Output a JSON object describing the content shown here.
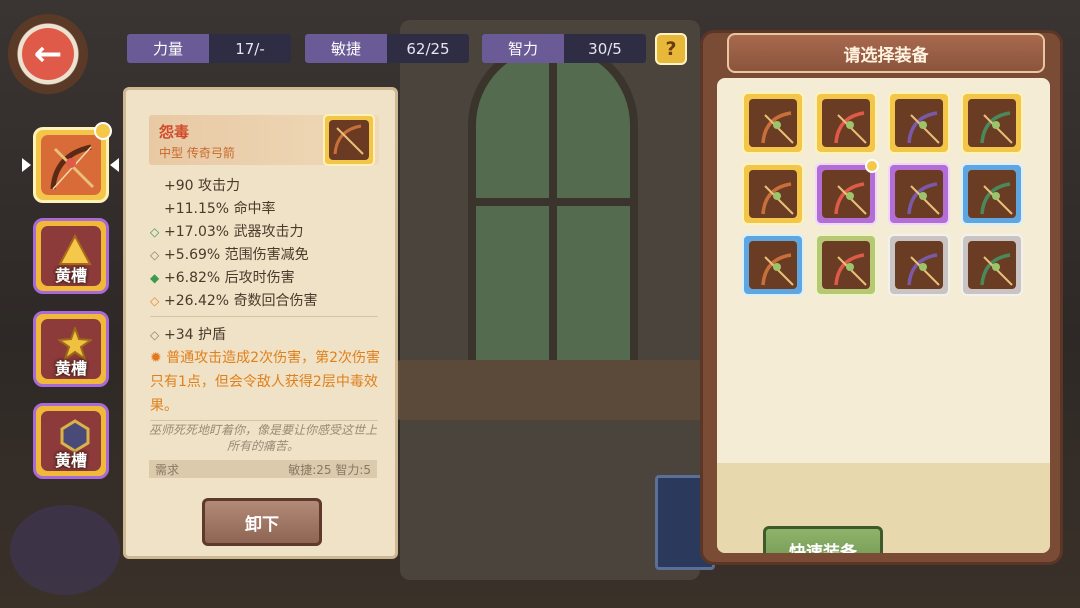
{
  "stats": [
    {
      "label": "力量",
      "value": "17/-"
    },
    {
      "label": "敏捷",
      "value": "62/25"
    },
    {
      "label": "智力",
      "value": "30/5"
    }
  ],
  "help_icon": "?",
  "back_icon": "arrow-left-icon",
  "slots": [
    {
      "label": "",
      "rarity": "gold",
      "icon": "bow-icon",
      "selected": true
    },
    {
      "label": "黄槽",
      "rarity": "gold",
      "icon": "topaz-gem-icon"
    },
    {
      "label": "黄槽",
      "rarity": "gold",
      "icon": "gold-gem-icon"
    },
    {
      "label": "黄槽",
      "rarity": "gold",
      "icon": "dark-gem-icon"
    }
  ],
  "detail": {
    "name": "怨毒",
    "type": "中型 传奇弓箭",
    "attributes": [
      {
        "marker": "",
        "text": "+90 攻击力"
      },
      {
        "marker": "",
        "text": "+11.15% 命中率"
      },
      {
        "marker": "green",
        "text": "+17.03% 武器攻击力"
      },
      {
        "marker": "gray",
        "text": "+5.69% 范围伤害减免"
      },
      {
        "marker": "green",
        "text": "+6.82% 后攻时伤害"
      },
      {
        "marker": "orange",
        "text": "+26.42% 奇数回合伤害"
      }
    ],
    "shield": "+34 护盾",
    "effect": "普通攻击造成2次伤害，第2次伤害只有1点，但会令敌人获得2层中毒效果。",
    "lore": "巫师死死地盯着你，像是要让你感受这世上所有的痛苦。",
    "requirement_label": "需求",
    "requirement_value": "敏捷:25 智力:5",
    "unequip_label": "卸下"
  },
  "select_panel": {
    "title": "请选择装备",
    "quick_equip_label": "快速装备",
    "items": [
      {
        "rarity": "gold",
        "icon": "bow-icon"
      },
      {
        "rarity": "gold",
        "icon": "bow-icon"
      },
      {
        "rarity": "gold",
        "icon": "bow-icon"
      },
      {
        "rarity": "gold",
        "icon": "bow-icon"
      },
      {
        "rarity": "gold",
        "icon": "bow-icon"
      },
      {
        "rarity": "purple",
        "icon": "bow-icon",
        "equipped": true
      },
      {
        "rarity": "purple",
        "icon": "bow-icon"
      },
      {
        "rarity": "blue",
        "icon": "bow-icon"
      },
      {
        "rarity": "blue",
        "icon": "bow-icon"
      },
      {
        "rarity": "green",
        "icon": "bow-icon"
      },
      {
        "rarity": "gray",
        "icon": "bow-icon"
      },
      {
        "rarity": "gray",
        "icon": "bow-icon"
      }
    ]
  },
  "colors": {
    "gold": "#f3c64a",
    "purple": "#b36ed6",
    "blue": "#5fa6e0",
    "green": "#b6c874",
    "gray": "#c9c4c2",
    "effect_text": "#e0801c",
    "item_name": "#d04a2a"
  }
}
